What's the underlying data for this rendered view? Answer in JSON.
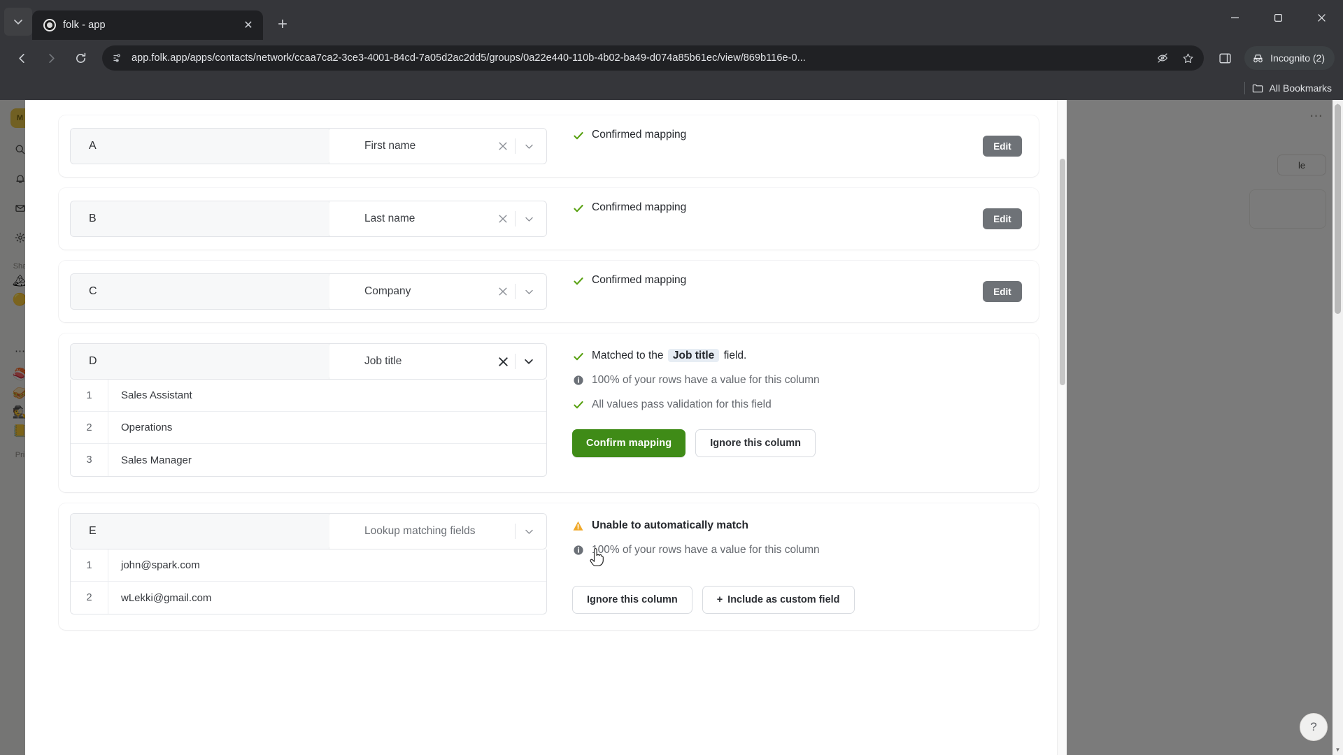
{
  "browser": {
    "tab": {
      "title": "folk - app",
      "close_label": "✕"
    },
    "new_tab_label": "+",
    "tab_search_label": "⌄",
    "window": {
      "minimize": "—",
      "maximize": "❐",
      "close": "✕"
    },
    "nav": {
      "back": "←",
      "forward": "→",
      "reload": "⟳"
    },
    "url": "app.folk.app/apps/contacts/network/ccaa7ca2-3ce3-4001-84cd-7a05d2ac2dd5/groups/0a22e440-110b-4b02-ba49-d074a85b61ec/view/869b116e-0...",
    "incognito_label": "Incognito (2)",
    "bookmarks_label": "All Bookmarks"
  },
  "app_background": {
    "workspace_initials": "M",
    "section_label": "Sha",
    "privacy_label": "Pri",
    "ghost_button": "le",
    "more_dots": "⋯"
  },
  "importer": {
    "columns": [
      {
        "letter": "A",
        "field": "First name",
        "status_text": "Confirmed mapping",
        "status_icon": "check-icon",
        "edit_label": "Edit",
        "state": "confirmed"
      },
      {
        "letter": "B",
        "field": "Last name",
        "status_text": "Confirmed mapping",
        "status_icon": "check-icon",
        "edit_label": "Edit",
        "state": "confirmed"
      },
      {
        "letter": "C",
        "field": "Company",
        "status_text": "Confirmed mapping",
        "status_icon": "check-icon",
        "edit_label": "Edit",
        "state": "confirmed"
      },
      {
        "letter": "D",
        "field": "Job title",
        "state": "matched",
        "preview_rows": [
          {
            "num": "1",
            "value": "Sales Assistant"
          },
          {
            "num": "2",
            "value": "Operations"
          },
          {
            "num": "3",
            "value": "Sales Manager"
          }
        ],
        "messages": {
          "matched_prefix": "Matched to the",
          "matched_chip": "Job title",
          "matched_suffix": "field.",
          "coverage": "100% of your rows have a value for this column",
          "validation": "All values pass validation for this field"
        },
        "buttons": {
          "confirm": "Confirm mapping",
          "ignore": "Ignore this column"
        }
      },
      {
        "letter": "E",
        "field": "Lookup matching fields",
        "state": "unmatched",
        "preview_rows": [
          {
            "num": "1",
            "value": "john@spark.com"
          },
          {
            "num": "2",
            "value": "wLekki@gmail.com"
          }
        ],
        "messages": {
          "warning": "Unable to automatically match",
          "coverage": "100% of your rows have a value for this column"
        },
        "buttons": {
          "ignore": "Ignore this column",
          "include": "Include as custom field",
          "include_prefix": "+"
        }
      }
    ]
  },
  "help": {
    "label": "?"
  },
  "colors": {
    "confirm_green": "#3f8b17",
    "check_green": "#5aa214",
    "warning_amber": "#f0a92a",
    "info_grey": "#6b7077",
    "edit_grey": "#6e7277",
    "chip_bg": "#e7edf4"
  }
}
